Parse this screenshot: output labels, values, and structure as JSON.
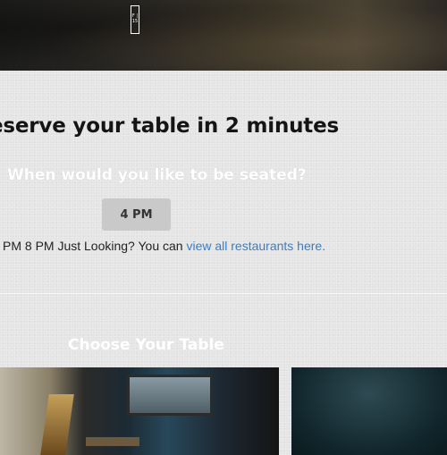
{
  "hero": {
    "badge_text": "F | 15"
  },
  "reservation": {
    "headline": "eserve your table in 2 minutes",
    "question": "When would you like to be seated?",
    "selected_time": "4 PM",
    "times_text": "PM 8 PM Just Looking? You can ",
    "link_text": "view all restaurants here."
  },
  "tables": {
    "heading": "Choose Your Table"
  },
  "colors": {
    "link": "#3b7dc4",
    "time_button_bg": "#c9c9c9"
  }
}
